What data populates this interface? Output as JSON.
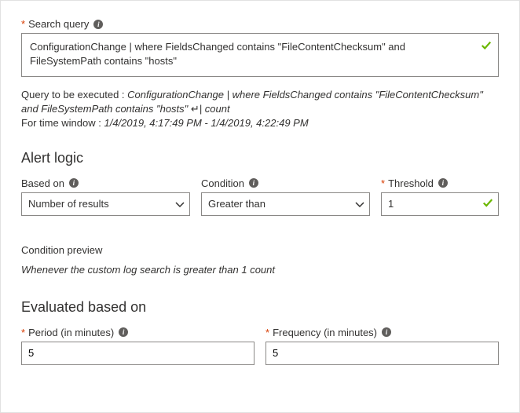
{
  "searchQuery": {
    "label": "Search query",
    "value": "ConfigurationChange | where FieldsChanged contains \"FileContentChecksum\" and FileSystemPath contains \"hosts\""
  },
  "executedQuery": {
    "prefix": "Query to be executed : ",
    "text": "ConfigurationChange | where FieldsChanged contains \"FileContentChecksum\" and FileSystemPath contains \"hosts\" ",
    "suffix": "| count",
    "timePrefix": "For time window : ",
    "timeRange": "1/4/2019, 4:17:49 PM - 1/4/2019, 4:22:49 PM"
  },
  "alertLogic": {
    "heading": "Alert logic",
    "basedOnLabel": "Based on",
    "basedOnValue": "Number of results",
    "conditionLabel": "Condition",
    "conditionValue": "Greater than",
    "thresholdLabel": "Threshold",
    "thresholdValue": "1"
  },
  "conditionPreview": {
    "label": "Condition preview",
    "text": "Whenever the custom log search is greater than 1 count"
  },
  "evaluated": {
    "heading": "Evaluated based on",
    "periodLabel": "Period (in minutes)",
    "periodValue": "5",
    "frequencyLabel": "Frequency (in minutes)",
    "frequencyValue": "5"
  }
}
